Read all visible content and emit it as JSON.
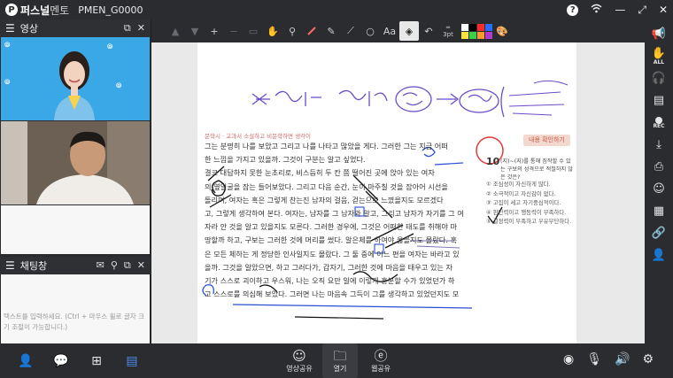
{
  "titlebar": {
    "brand_main": "퍼스널",
    "brand_sub": "멘토",
    "room_id": "PMEN_G0000"
  },
  "video_panel": {
    "title": "영상"
  },
  "chat_panel": {
    "title": "채팅창",
    "placeholder": "텍스트를 입력하세요. (Ctrl + 마우스 휠로 글자 크기 조절이 가능합니다.)"
  },
  "toolbar": {
    "text_tool": "Aa",
    "stroke_size": "3pt",
    "colors": [
      "#ffffff",
      "#000000",
      "#ff2a2a",
      "#2a6cff",
      "#ffe33a",
      "#3ad14a",
      "#ff9a2a",
      "#b23ad1"
    ]
  },
  "document": {
    "book_tag": "문학시  · 교과서 소설하고 비문학하면 생각이",
    "lines": [
      "그는 분명히 나를 보았고 그리고 나를 나타고 많았을 게다. 그러한 그는 지금 어떠",
      "한 느낌을 가지고 있을까. 그것이 구분는 알고 싶었다.",
      "결코 대답하지 못한 눈초리로, 비스듬히 두 칸 쯤 떨어진 곳에 앉아 있는 여자",
      "의 옆얼굴을 잠는 들어보았다. 그리고 다음 순간, 눈이 마주칠 것을 잡아어 시선을",
      "돌리며, 여자는 혹은 그렇게 찬는진 남자의 걸음, 걷는으로 느꼈을지도 모르겠다",
      "고, 그렇게 생각하여 본다. 여자는, 남자를 그 남자와 알고, 그리고 남자가 자기를 그 여",
      "자라 안 것을 알고 있을지도 모른다. 그러한 경우에, 그것은 어떠한 태도를 취해야 마",
      "땅할까 하고, 구보는 그러한 것에 머리를 썼다. 알은체를 하여야 옳을지도 몰랐다. 혹",
      "은 모든 체하는 게 정당한 인사일지도 몰랐다. 그 둘 중에 어느 편을 여자는 바라고 있",
      "을까. 그것을 알았으면, 하고 그러다가, 갑자기, 그러한 것에 마음을 태우고 있는 자",
      "기가 스스로 괴이하고 우스워, 나는 오직 요만 일에 이렇게 흥분할 수가 있었던가 하",
      "고 스스로를 의심해 보았다. 그러면 나는 마음속 그득이 그를 생각하고 있었던지도 모"
    ],
    "side_tab": "내용 확인하기",
    "question_number": "10",
    "question_text": "(지)~(지)를 통해 짐작할 수 있는 구보의 성격으로 적절하지 않은 것은?",
    "options": [
      "① 조심성이 자신하게 많다.",
      "② 소극적이고 자신감이 없다.",
      "③ 고집이 세고 자기중심적이다.",
      "④ 판단력이고 행동력이 부족하다.",
      "⑤ 결정력이 부족하고 우유부단하다."
    ]
  },
  "bottombar": {
    "share_video": "영상공유",
    "open": "열기",
    "web_share": "웹공유"
  }
}
